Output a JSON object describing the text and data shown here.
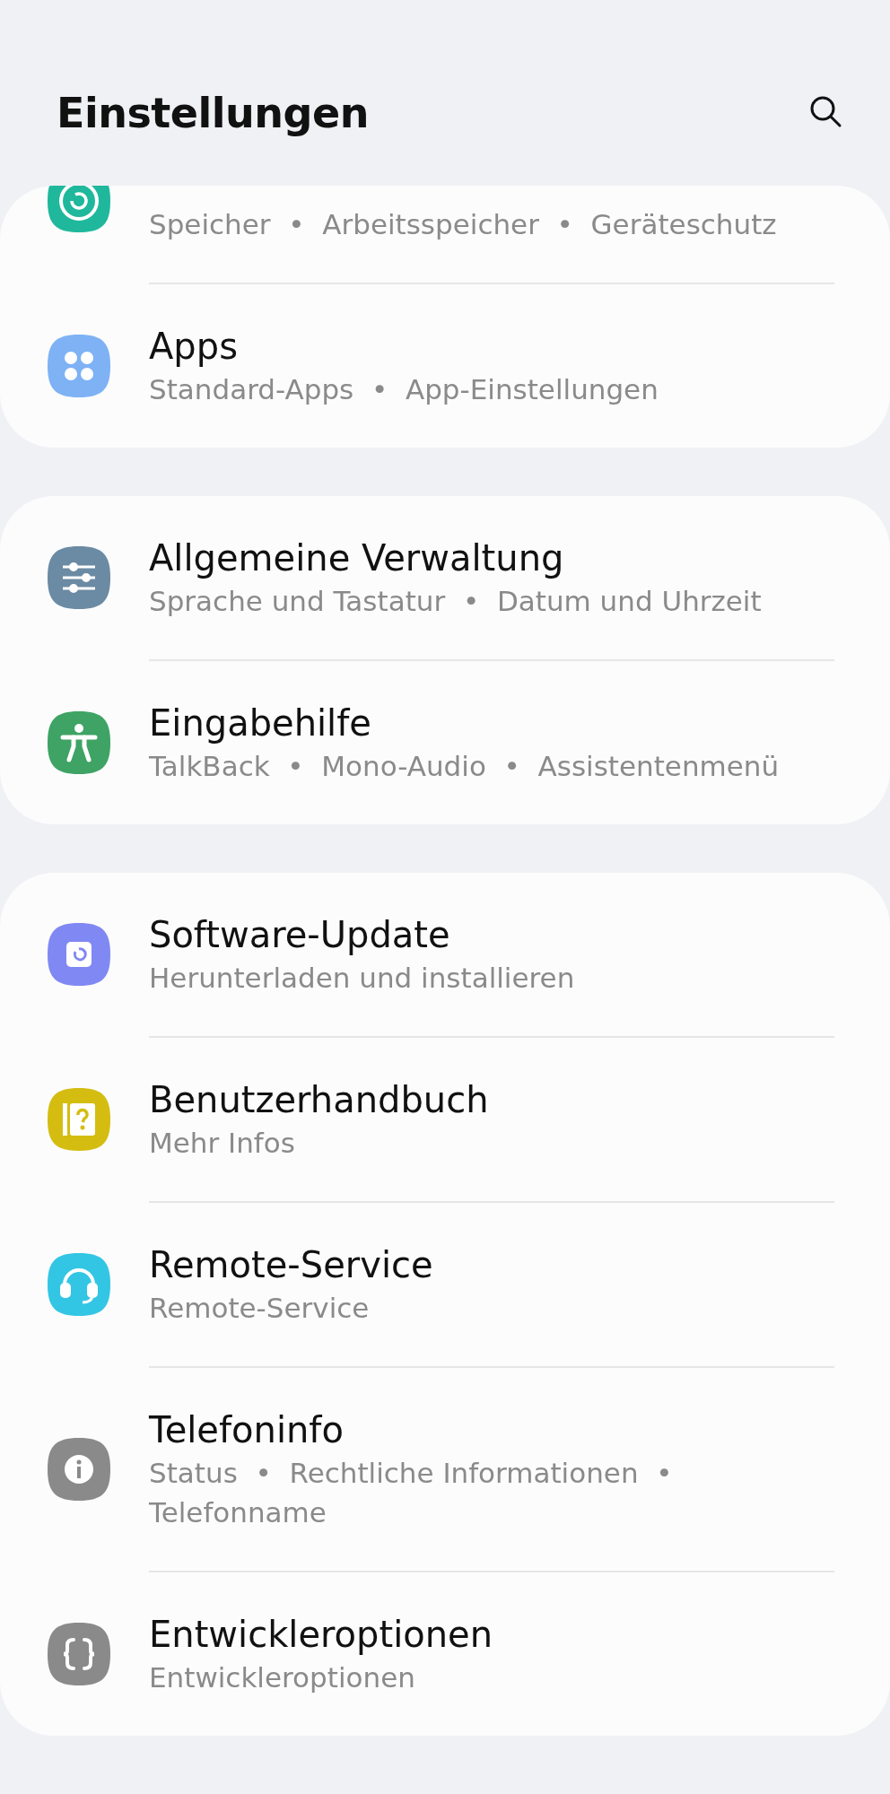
{
  "header": {
    "title": "Einstellungen"
  },
  "groups": [
    {
      "items": [
        {
          "subtitle": "Speicher  •  Arbeitsspeicher  •  Geräteschutz",
          "color": "#1fb89c",
          "cut": true
        },
        {
          "title": "Apps",
          "subtitle": "Standard-Apps  •  App-Einstellungen",
          "color": "#7eb2f5"
        }
      ]
    },
    {
      "items": [
        {
          "title": "Allgemeine Verwaltung",
          "subtitle": "Sprache und Tastatur  •  Datum und Uhrzeit",
          "color": "#6b8aa3"
        },
        {
          "title": "Eingabehilfe",
          "subtitle": "TalkBack  •  Mono-Audio  •  Assistentenmenü",
          "color": "#3ea364"
        }
      ]
    },
    {
      "items": [
        {
          "title": "Software-Update",
          "subtitle": "Herunterladen und installieren",
          "color": "#8088f3"
        },
        {
          "title": "Benutzerhandbuch",
          "subtitle": "Mehr Infos",
          "color": "#d4bd10"
        },
        {
          "title": "Remote-Service",
          "subtitle": "Remote-Service",
          "color": "#33c6e4"
        },
        {
          "title": "Telefoninfo",
          "subtitle": "Status  •  Rechtliche Informationen  •  Telefonname",
          "color": "#8a8a8a"
        },
        {
          "title": "Entwickleroptionen",
          "subtitle": "Entwickleroptionen",
          "color": "#8a8a8a"
        }
      ]
    }
  ]
}
